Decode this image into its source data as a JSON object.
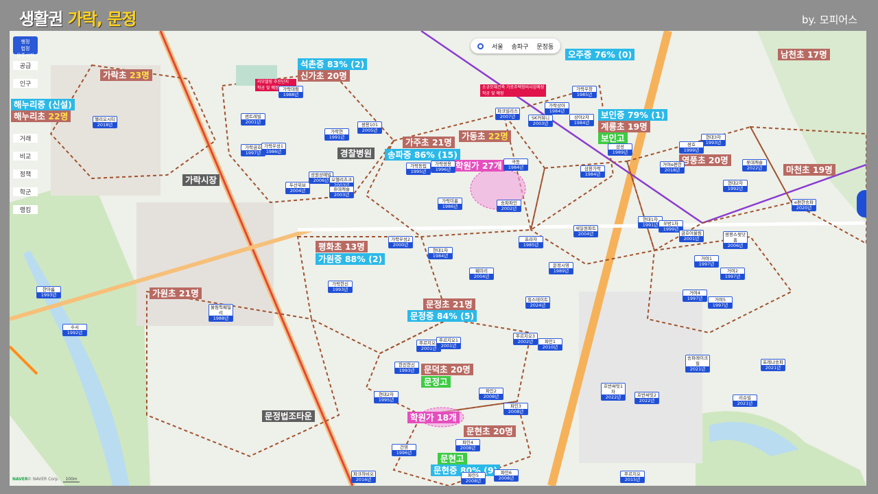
{
  "header": {
    "title_main": "생활권 ",
    "title_highlight": "가락, 문정",
    "byline": "by. 모피어스"
  },
  "nav": {
    "region1": "서울",
    "region2": "송파구",
    "region3": "문정동"
  },
  "side_controls": {
    "top": "행정\n법정\n읍주시기",
    "items": [
      "공급",
      "인구",
      "거래",
      "비교",
      "정책",
      "학군",
      "랭킹"
    ]
  },
  "labels": {
    "garak_elem": {
      "name": "가락초 ",
      "count": "23명"
    },
    "haenuri_mid": "해누리중 (신설)",
    "haenuri_elem": {
      "name": "해누리초 ",
      "count": "22명"
    },
    "seokchon_mid": "석촌중 83% (2)",
    "singa_elem": "신가초 20명",
    "police_hospital": "경찰병원",
    "garak_market": "가락시장",
    "songpa_mid": "송파중 86% (15)",
    "gaju_elem": "가주초 21명",
    "gadong_elem": {
      "name": "가동초 ",
      "count": "22명"
    },
    "academy_27": "학원가 27개",
    "ogeum_mid": "오주중 76% (0)",
    "namcheon_elem": "남천초 17명",
    "boin_mid": "보인중 79% (1)",
    "gyeryong_elem": "계룡초 19명",
    "boin_high": "보인고",
    "yeongpung_elem": "영풍초 20명",
    "macheon_elem": "마천초 19명",
    "pyeonghwa_elem": "평화초 13명",
    "gawon_mid": "가원중 88% (2)",
    "gawon_elem": "가원초 21명",
    "munjeong_elem": "문정초 21명",
    "munjeong_mid": "문정중 84% (5)",
    "mundeok_elem": "문덕초 20명",
    "munjeong_high": "문정고",
    "academy_18": "학원가 18개",
    "munjeong_court": "문정법조타운",
    "munhyeon_elem": "문현초 20명",
    "munhyeon_high": "문현고",
    "munhyeon_mid": "문현중 80% (9)"
  },
  "notices": {
    "garak_redevelop": "리모델링 추진단지\n착공 및 예정",
    "ogeum_redevelop": "소규모재건축 가로주택정비사업예정\n착공 및 예정"
  },
  "apartments": [
    {
      "name": "헬리오시티",
      "year": "2018년"
    },
    {
      "name": "가락대림",
      "year": "1988년"
    },
    {
      "name": "센트레빌",
      "year": "2001년"
    },
    {
      "name": "가락금호",
      "year": "1997년"
    },
    {
      "name": "가락우성1",
      "year": "1986년"
    },
    {
      "name": "가락현",
      "year": "1991년"
    },
    {
      "name": "쌍용101",
      "year": "2005년"
    },
    {
      "name": "두산위브",
      "year": "2004년"
    },
    {
      "name": "성원상떼빌",
      "year": "2006년"
    },
    {
      "name": "오헬리츠크",
      "year": "2003년"
    },
    {
      "name": "휴데캐슬",
      "year": "2003년"
    },
    {
      "name": "가락동립",
      "year": "1995년"
    },
    {
      "name": "가락쌍용",
      "year": "1996년"
    },
    {
      "name": "가락미륭",
      "year": "1986년"
    },
    {
      "name": "파크빌리스",
      "year": "2007년"
    },
    {
      "name": "SK커뮤니",
      "year": "2003년"
    },
    {
      "name": "가락상아",
      "year": "1984년"
    },
    {
      "name": "가락우창",
      "year": "1985년"
    },
    {
      "name": "상아2차",
      "year": "1984년"
    },
    {
      "name": "극동",
      "year": "1984년"
    },
    {
      "name": "송파파인",
      "year": "2002년"
    },
    {
      "name": "삼환가락",
      "year": "1984년"
    },
    {
      "name": "삼성",
      "year": "1989년"
    },
    {
      "name": "현대3차",
      "year": "1993년"
    },
    {
      "name": "쌍호",
      "year": "1999년"
    },
    {
      "name": "거여e편한",
      "year": "2018년"
    },
    {
      "name": "롯데캐슬",
      "year": "2022년"
    },
    {
      "name": "현대2차",
      "year": "1992년"
    },
    {
      "name": "e편한송파",
      "year": "2020년"
    },
    {
      "name": "현대1차",
      "year": "1991년"
    },
    {
      "name": "우방1차",
      "year": "1999년"
    },
    {
      "name": "금호어울림",
      "year": "2001년"
    },
    {
      "name": "쌍용스윗닷홈",
      "year": "2006년"
    },
    {
      "name": "새일원파트",
      "year": "2004년"
    },
    {
      "name": "프라자",
      "year": "1985년"
    },
    {
      "name": "가락우성2",
      "year": "2000년"
    },
    {
      "name": "현대1차",
      "year": "1984년"
    },
    {
      "name": "문정시영",
      "year": "1989년"
    },
    {
      "name": "훼미리",
      "year": "2004년"
    },
    {
      "name": "거여1",
      "year": "1997년"
    },
    {
      "name": "거여2",
      "year": "1997년"
    },
    {
      "name": "거여4",
      "year": "1997년"
    },
    {
      "name": "거여5",
      "year": "1997년"
    },
    {
      "name": "가락한신",
      "year": "1993년"
    },
    {
      "name": "한아름",
      "year": "1993년"
    },
    {
      "name": "올림픽훼밀리",
      "year": "1988년"
    },
    {
      "name": "힐스테이트",
      "year": "2024년"
    },
    {
      "name": "수서",
      "year": "1992년"
    },
    {
      "name": "푸르지오2",
      "year": "2001년"
    },
    {
      "name": "푸르지오1",
      "year": "2001년"
    },
    {
      "name": "푸르지오3",
      "year": "2002년"
    },
    {
      "name": "파인1",
      "year": "2010년"
    },
    {
      "name": "한진한신",
      "year": "1993년"
    },
    {
      "name": "송파레이크힐",
      "year": "2021년"
    },
    {
      "name": "포레나송파",
      "year": "2021년"
    },
    {
      "name": "현대2차",
      "year": "1995년"
    },
    {
      "name": "파인2",
      "year": "2008년"
    },
    {
      "name": "파인3",
      "year": "2008년"
    },
    {
      "name": "호반써밋1차",
      "year": "2022년"
    },
    {
      "name": "호반써밋2",
      "year": "2022년"
    },
    {
      "name": "리슈빌",
      "year": "2021년"
    },
    {
      "name": "건영",
      "year": "1996년"
    },
    {
      "name": "파인4",
      "year": "2008년"
    },
    {
      "name": "파인5",
      "year": "2008년"
    },
    {
      "name": "파인6",
      "year": "2008년"
    },
    {
      "name": "파크하비오",
      "year": "2016년"
    },
    {
      "name": "푸르지오",
      "year": "2015년"
    }
  ],
  "footer": {
    "naver": "NAVER",
    "copyright": "© NAVER Corp.",
    "scale": "100m"
  },
  "colors": {
    "school_label": "#b86a62",
    "mid_label": "#2bb9e8",
    "high_label": "#3ecb44",
    "academy_label": "#e54fbd",
    "district_line": "#a0522d"
  }
}
